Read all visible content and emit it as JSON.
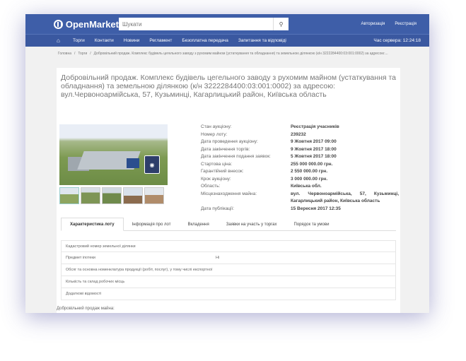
{
  "header": {
    "logo": "OpenMarket",
    "search_placeholder": "Шукати",
    "login": "Авторизація",
    "register": "Реєстрація"
  },
  "nav": {
    "items": [
      "Торги",
      "Контакти",
      "Новини",
      "Регламент",
      "Безоплатна передача",
      "Запитання та відповіді"
    ],
    "server_time": "Час сервера: 12:24:18"
  },
  "breadcrumb": {
    "home": "Головна",
    "sep": "/",
    "auctions": "Торги",
    "current": "Добровільний продаж. Комплекс будівель цегельного заводу з рухомим майном (устаткування та обладнання) та земельною ділянкою (к/н 3222284400:03:001:0002) за адресою:..."
  },
  "lot": {
    "title": "Добровільний продаж. Комплекс будівель цегельного заводу з рухомим майном (устаткування та обладнання) та земельною ділянкою (к/н 3222284400:03:001:0002) за адресою: вул.Червоноармійська, 57, Кузьминці, Кагарлицький район, Київська область",
    "info": [
      {
        "label": "Стан аукціону:",
        "value": "Реєстрація учасників"
      },
      {
        "label": "Номер лоту:",
        "value": "239232"
      },
      {
        "label": "Дата проведення аукціону:",
        "value": "9 Жовтня 2017 09:00"
      },
      {
        "label": "Дата закінчення торгів:",
        "value": "9 Жовтня 2017 18:00"
      },
      {
        "label": "Дата закінчення подання заявок:",
        "value": "5 Жовтня 2017 18:00"
      },
      {
        "label": "Стартова ціна:",
        "value": "255 000 000.00 грн."
      },
      {
        "label": "Гарантійний внесок:",
        "value": "2 550 000.00 грн."
      },
      {
        "label": "Крок аукціону:",
        "value": "3 000 000.00 грн."
      },
      {
        "label": "Область:",
        "value": "Київська обл."
      },
      {
        "label": "Місцезнаходження майна:",
        "value": "вул. Червоноармійська, 57, Кузьминці, Кагарлицький район, Київська область"
      },
      {
        "label": "Дата публікації:",
        "value": "15 Вересня 2017 12:35"
      }
    ]
  },
  "tabs": [
    "Характеристика лоту",
    "Інформація про лот",
    "Вкладення",
    "Заявки на участь у торгах",
    "Порядок та умови"
  ],
  "properties": [
    {
      "label": "Кадастровий номер земельної ділянки",
      "value": ""
    },
    {
      "label": "Предмет іпотеки",
      "value": "Ні"
    },
    {
      "label": "Обсяг та основна номенклатура продукції (робіт, послуг), у тому числі експортної",
      "value": ""
    },
    {
      "label": "Кількість та склад робочих місць",
      "value": ""
    },
    {
      "label": "Додаткові відомості",
      "value": ""
    }
  ],
  "description": "Добровільний продаж майна:"
}
